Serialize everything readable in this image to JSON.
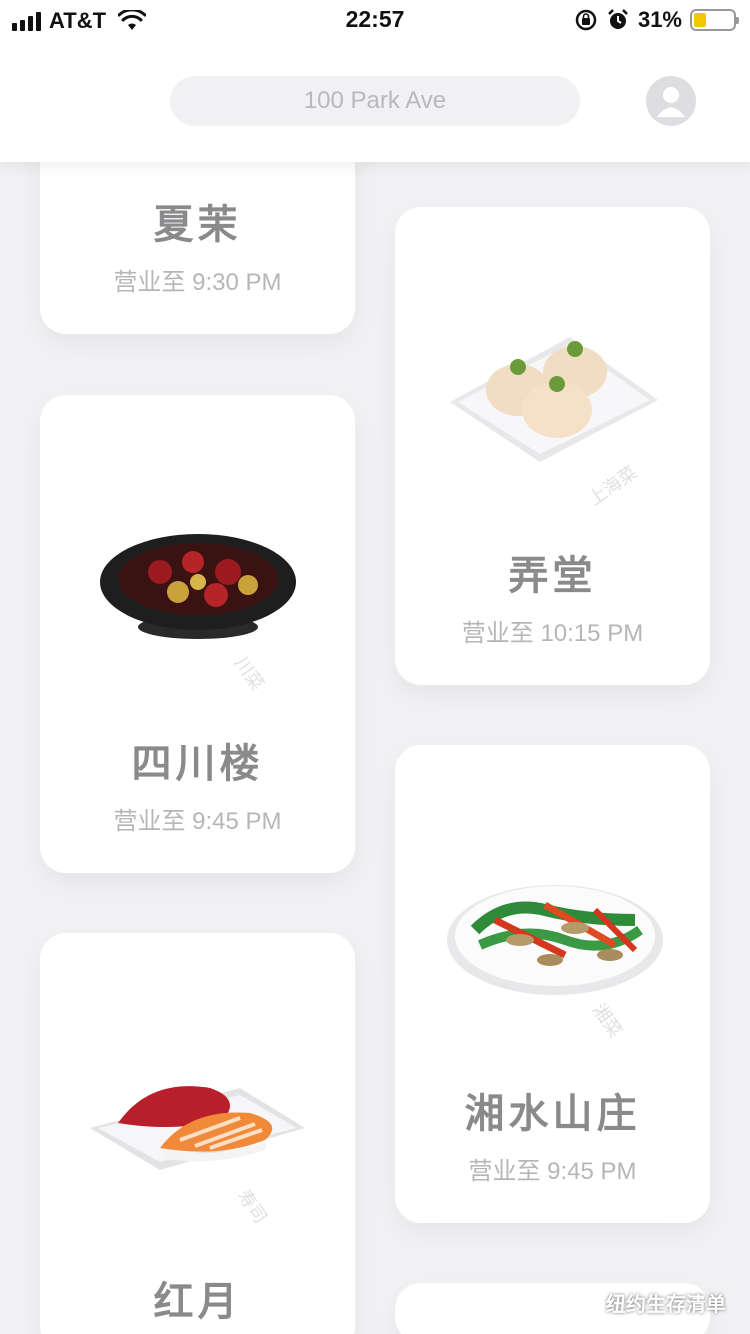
{
  "status_bar": {
    "carrier": "AT&T",
    "time": "22:57",
    "battery_percent": "31%",
    "battery_level": 0.31,
    "icons": [
      "signal-icon",
      "wifi-icon",
      "rotation-lock-icon",
      "alarm-icon",
      "battery-icon"
    ]
  },
  "header": {
    "address": "100 Park Ave",
    "avatar_icon": "user-icon"
  },
  "restaurants": [
    {
      "name": "夏茉",
      "hours": "营业至 9:30 PM"
    },
    {
      "name": "弄堂",
      "hours": "营业至 10:15 PM",
      "tag": "上海菜"
    },
    {
      "name": "四川楼",
      "hours": "营业至 9:45 PM",
      "tag": "川菜"
    },
    {
      "name": "湘水山庄",
      "hours": "营业至 9:45 PM",
      "tag": "湘菜"
    },
    {
      "name": "红月",
      "hours": "",
      "tag": "寿司"
    }
  ],
  "watermark": {
    "text": "纽约生存清单",
    "icon": "wechat-icon"
  },
  "colors": {
    "background": "#f2f2f4",
    "card": "#ffffff",
    "battery": "#f2c900",
    "text_name": "#8a8a8c",
    "text_hours": "#b6b6b8"
  }
}
